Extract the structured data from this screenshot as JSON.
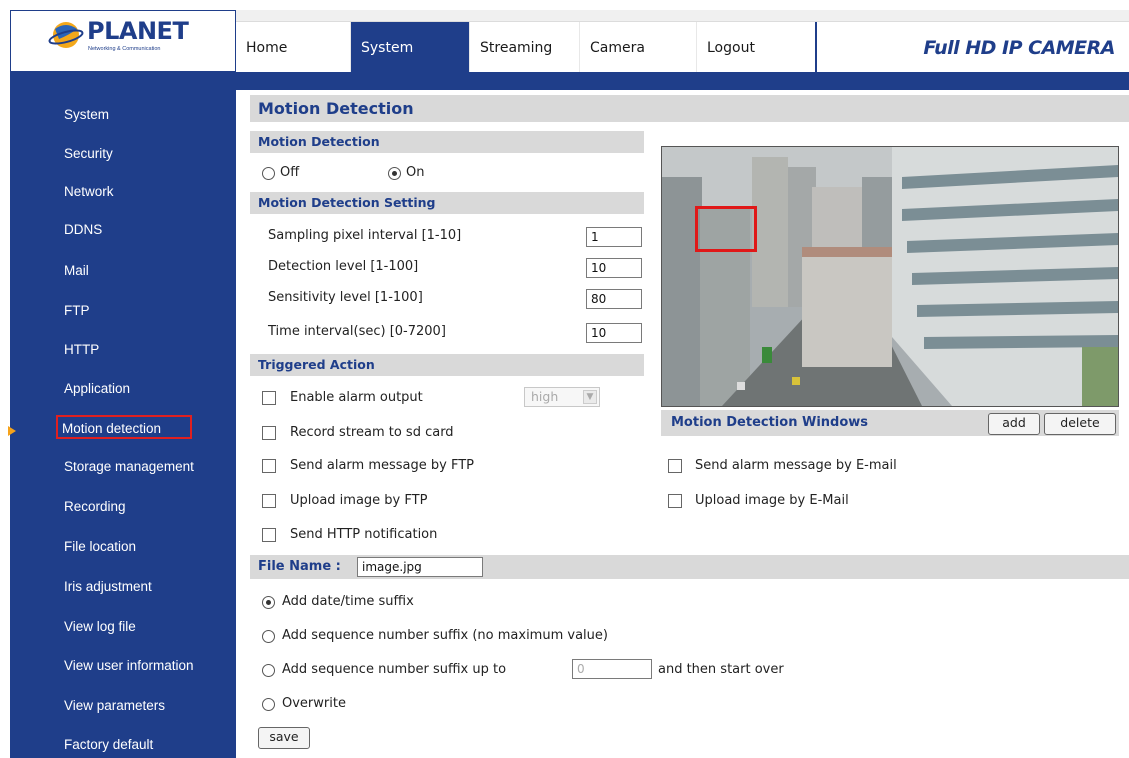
{
  "brand": {
    "logo_text": "PLANET",
    "logo_subtext": "Networking & Communication",
    "product_title": "Full HD IP CAMERA"
  },
  "nav": {
    "tabs": [
      "Home",
      "System",
      "Streaming",
      "Camera",
      "Logout"
    ],
    "active": "System"
  },
  "sidebar": {
    "items": [
      "System",
      "Security",
      "Network",
      "DDNS",
      "Mail",
      "FTP",
      "HTTP",
      "Application",
      "Motion detection",
      "Storage management",
      "Recording",
      "File location",
      "Iris adjustment",
      "View log file",
      "View user information",
      "View parameters",
      "Factory default"
    ],
    "selected": "Motion detection"
  },
  "page": {
    "title": "Motion Detection"
  },
  "motion_detection": {
    "section_title": "Motion Detection",
    "off_label": "Off",
    "on_label": "On",
    "selected": "On"
  },
  "settings": {
    "section_title": "Motion Detection Setting",
    "fields": [
      {
        "label": "Sampling pixel interval [1-10]",
        "value": "1"
      },
      {
        "label": "Detection level [1-100]",
        "value": "10"
      },
      {
        "label": "Sensitivity level [1-100]",
        "value": "80"
      },
      {
        "label": "Time interval(sec) [0-7200]",
        "value": "10"
      }
    ]
  },
  "triggered_action": {
    "section_title": "Triggered Action",
    "enable_alarm_output": "Enable alarm output",
    "alarm_level": "high",
    "record_stream": "Record stream to sd card",
    "send_alarm_ftp": "Send alarm message by FTP",
    "upload_image_ftp": "Upload image by FTP",
    "send_http": "Send HTTP notification",
    "send_alarm_email": "Send alarm message by E-mail",
    "upload_image_email": "Upload image by E-Mail"
  },
  "windows": {
    "title": "Motion Detection Windows",
    "add_label": "add",
    "delete_label": "delete"
  },
  "file_name": {
    "label": "File Name :",
    "value": "image.jpg",
    "option_date": "Add date/time suffix",
    "option_seq_nomax": "Add sequence number suffix (no maximum value)",
    "option_seq_upto": "Add sequence number suffix up to",
    "seq_upto_placeholder": "0",
    "option_seq_upto_tail": "and then start over",
    "option_overwrite": "Overwrite",
    "selected": "Add date/time suffix"
  },
  "save_label": "save",
  "colors": {
    "navy": "#1f3e8a",
    "section_grey": "#d9d9d9",
    "selection_red": "#e02020",
    "arrow_orange": "#f5a21a"
  }
}
